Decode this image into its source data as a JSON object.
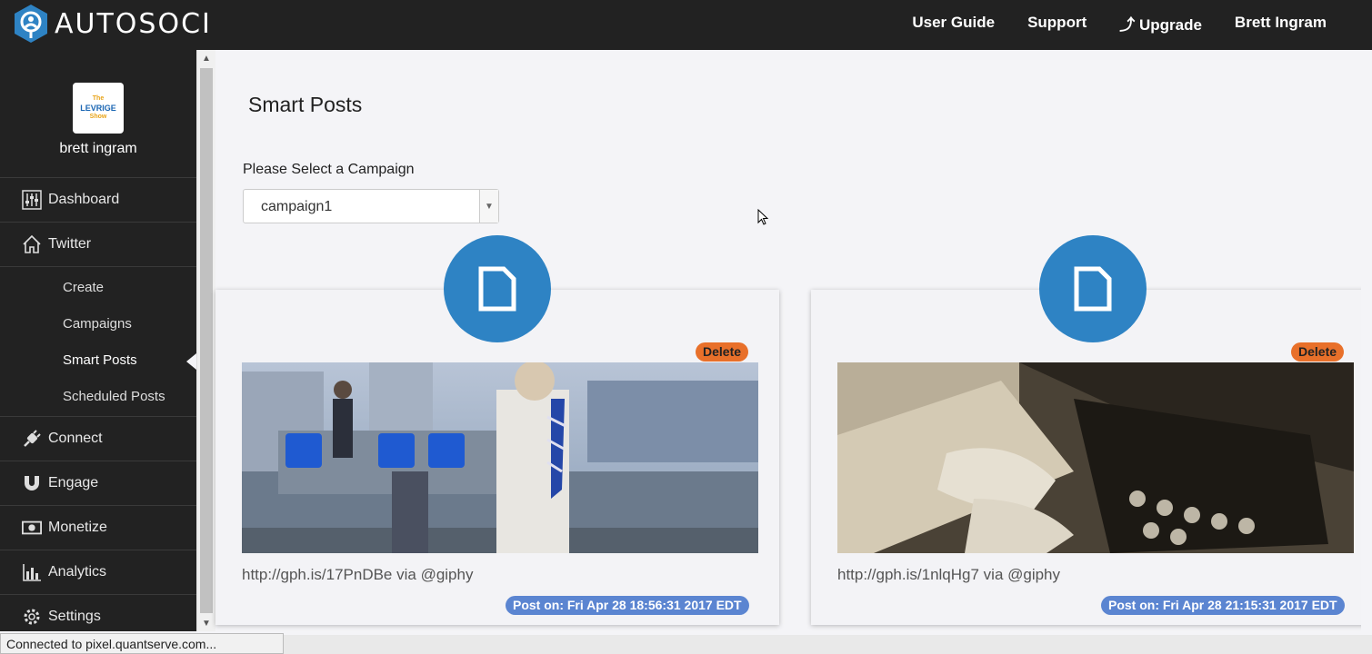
{
  "app": {
    "brand": "AUTOSOCI"
  },
  "topnav": {
    "user_guide": "User Guide",
    "support": "Support",
    "upgrade": "⤴ Upgrade",
    "user": "Brett Ingram"
  },
  "profile": {
    "name": "brett ingram",
    "logo_text_top": "The",
    "logo_text_main": "LEVRIGE",
    "logo_text_bottom": "Show"
  },
  "sidebar": {
    "items": [
      {
        "label": "Dashboard",
        "icon": "sliders-icon"
      },
      {
        "label": "Twitter",
        "icon": "home-icon"
      },
      {
        "label": "Connect",
        "icon": "plug-icon"
      },
      {
        "label": "Engage",
        "icon": "magnet-icon"
      },
      {
        "label": "Monetize",
        "icon": "money-icon"
      },
      {
        "label": "Analytics",
        "icon": "bar-chart-icon"
      },
      {
        "label": "Settings",
        "icon": "gear-icon"
      }
    ],
    "twitter_sub": [
      "Create",
      "Campaigns",
      "Smart Posts",
      "Scheduled Posts"
    ],
    "active_sub": "Smart Posts"
  },
  "main": {
    "title": "Smart Posts",
    "select_label": "Please Select a Campaign",
    "selected_campaign": "campaign1"
  },
  "posts": [
    {
      "delete_label": "Delete",
      "text": "http://gph.is/17PnDBe via @giphy",
      "date": "Post on: Fri Apr 28 18:56:31 2017 EDT"
    },
    {
      "delete_label": "Delete",
      "text": "http://gph.is/1nlqHg7 via @giphy",
      "date": "Post on: Fri Apr 28 21:15:31 2017 EDT"
    }
  ],
  "status_bar": {
    "text": "Connected to pixel.quantserve.com..."
  },
  "colors": {
    "topbar": "#222222",
    "sidebar": "#222222",
    "accent_blue": "#2e83c4",
    "delete_orange": "#e8702a",
    "date_badge": "#5b85d1"
  }
}
